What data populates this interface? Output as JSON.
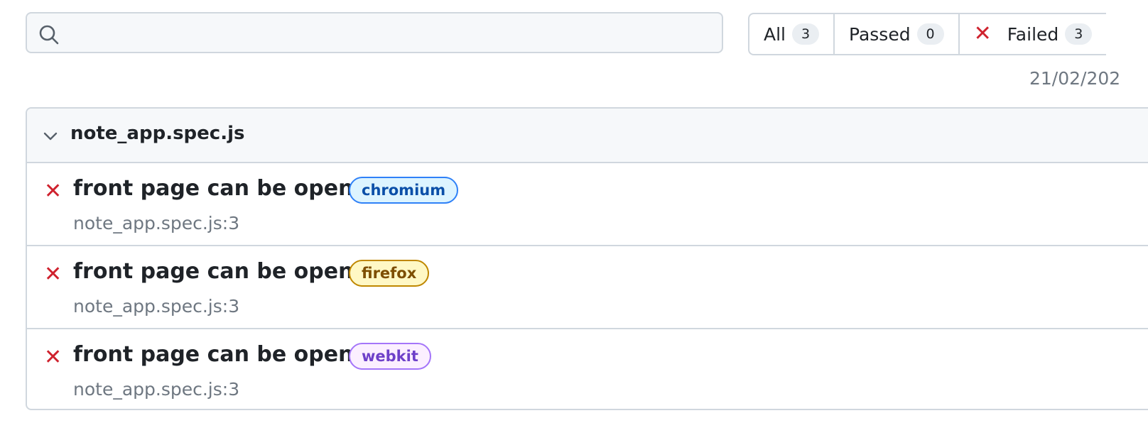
{
  "search": {
    "value": "",
    "placeholder": ""
  },
  "filters": [
    {
      "label": "All",
      "count": "3"
    },
    {
      "label": "Passed",
      "count": "0"
    },
    {
      "label": "Failed",
      "count": "3",
      "icon": "x-icon"
    }
  ],
  "report_date": "21/02/202",
  "file": {
    "name": "note_app.spec.js",
    "expanded": true,
    "tests": [
      {
        "title": "front page can be opened",
        "project": "chromium",
        "location": "note_app.spec.js:3",
        "status": "failed"
      },
      {
        "title": "front page can be opened",
        "project": "firefox",
        "location": "note_app.spec.js:3",
        "status": "failed"
      },
      {
        "title": "front page can be opened",
        "project": "webkit",
        "location": "note_app.spec.js:3",
        "status": "failed"
      }
    ]
  },
  "colors": {
    "failed": "#cf222e",
    "chromium": "#2f81f7",
    "firefox": "#bf8700",
    "webkit": "#a475f9",
    "border": "#d0d7de"
  }
}
